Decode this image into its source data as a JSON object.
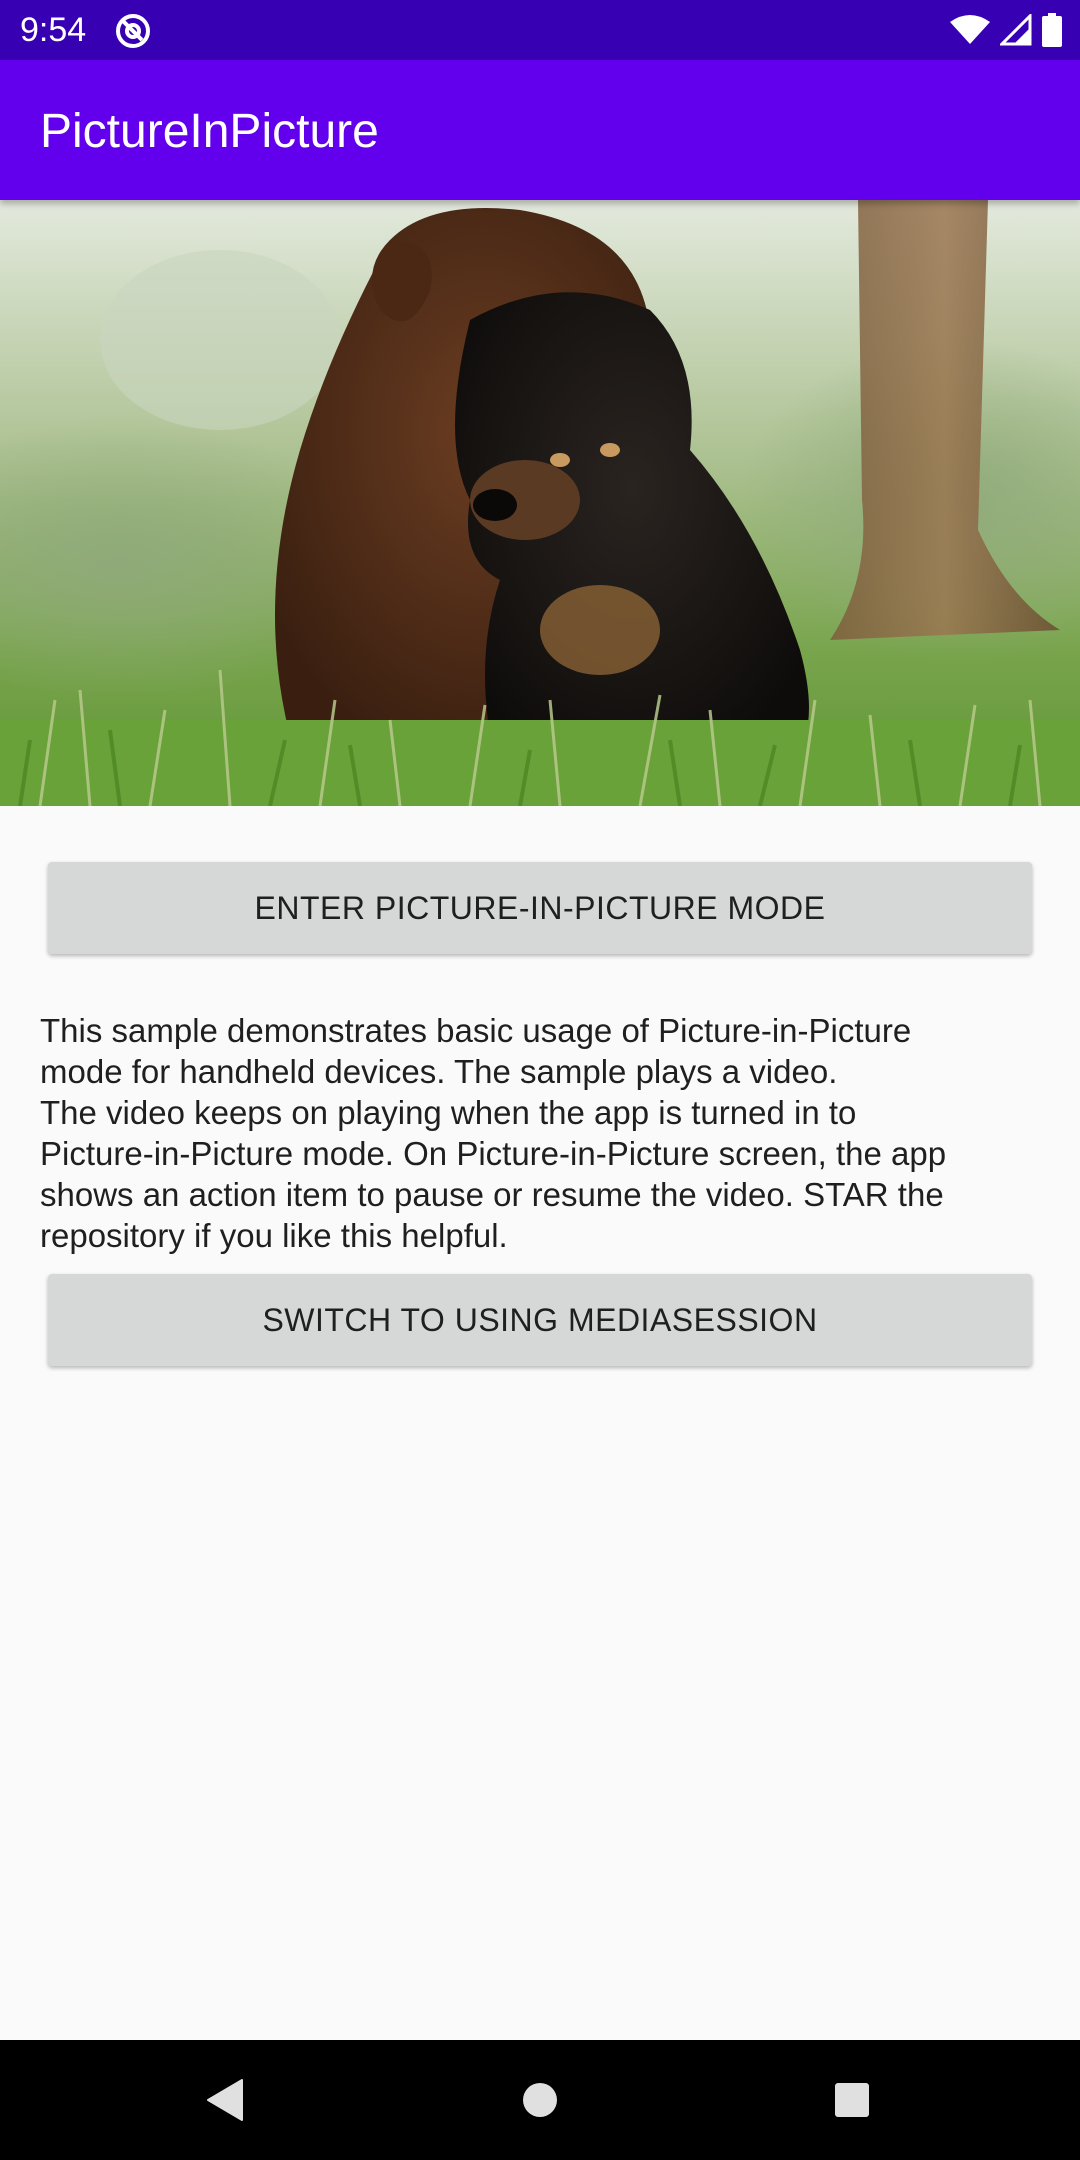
{
  "status_bar": {
    "time": "9:54",
    "left_icon": "at-sign-icon",
    "right_icons": [
      "wifi-icon",
      "cellular-signal-icon",
      "battery-icon"
    ]
  },
  "app_bar": {
    "title": "PictureInPicture",
    "color": "#6200ee",
    "status_color": "#3700b3"
  },
  "video": {
    "description": "video player showing two puppies sitting in the grass"
  },
  "buttons": {
    "enter_pip": "ENTER PICTURE-IN-PICTURE MODE",
    "switch_media": "SWITCH TO USING MEDIASESSION"
  },
  "description": {
    "lines": [
      "This sample demonstrates basic usage of Picture-in-Picture",
      "mode for handheld devices. The sample plays a video.",
      "The video keeps on playing when the app is turned in to",
      "Picture-in-Picture mode. On Picture-in-Picture screen, the app",
      "shows an action item to pause or resume the video. STAR the",
      "repository if you like this helpful."
    ]
  },
  "nav_bar": {
    "icons": [
      "back-icon",
      "home-icon",
      "recents-icon"
    ]
  }
}
